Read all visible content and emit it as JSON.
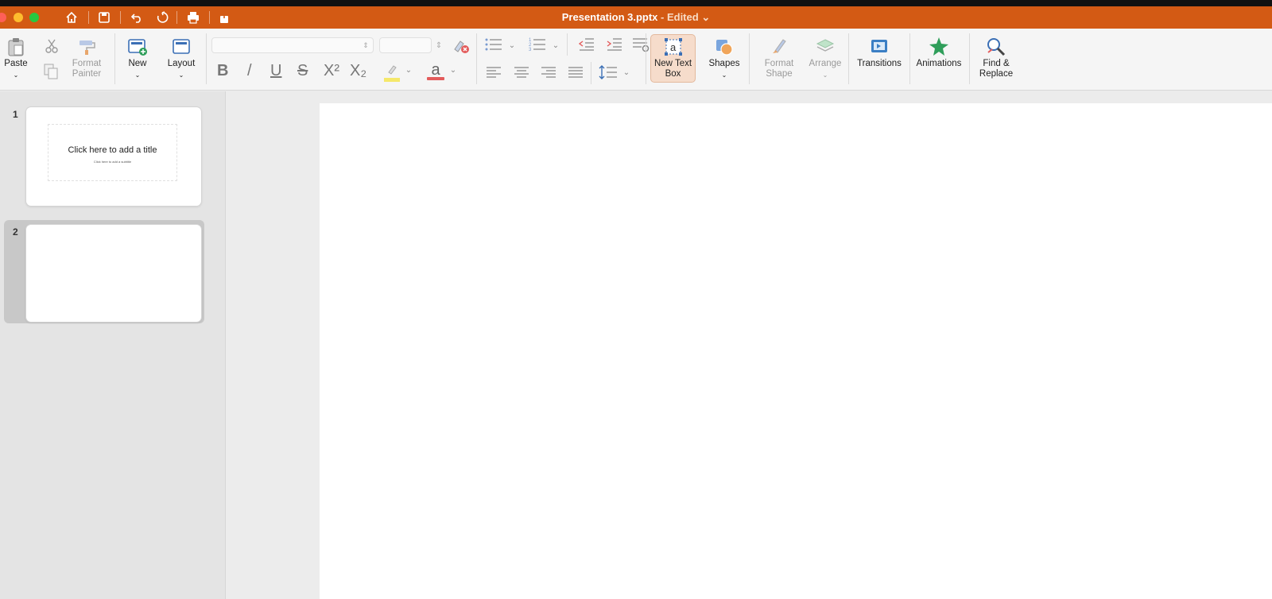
{
  "window": {
    "doc_name": "Presentation 3.pptx",
    "status": " - Edited",
    "status_caret": "⌄"
  },
  "toolbar": {
    "paste": "Paste",
    "format_painter": "Format\nPainter",
    "new": "New",
    "layout": "Layout",
    "new_text_box": "New Text\nBox",
    "shapes": "Shapes",
    "format_shape": "Format\nShape",
    "arrange": "Arrange",
    "transitions": "Transitions",
    "animations": "Animations",
    "find_replace": "Find &\nReplace",
    "caret": "⌄"
  },
  "formatting": {
    "bold": "B",
    "italic": "/",
    "underline": "U",
    "strike": "S",
    "superscript": "X²",
    "subscript": "X₂",
    "font_color_letter": "a"
  },
  "slides": [
    {
      "number": "1",
      "title": "Click here to add a title",
      "subtitle": "Click here to add a subtitle"
    },
    {
      "number": "2"
    }
  ],
  "colors": {
    "accent": "#d35a14",
    "highlight": "#f5e86a",
    "font_color": "#e35b5b"
  }
}
